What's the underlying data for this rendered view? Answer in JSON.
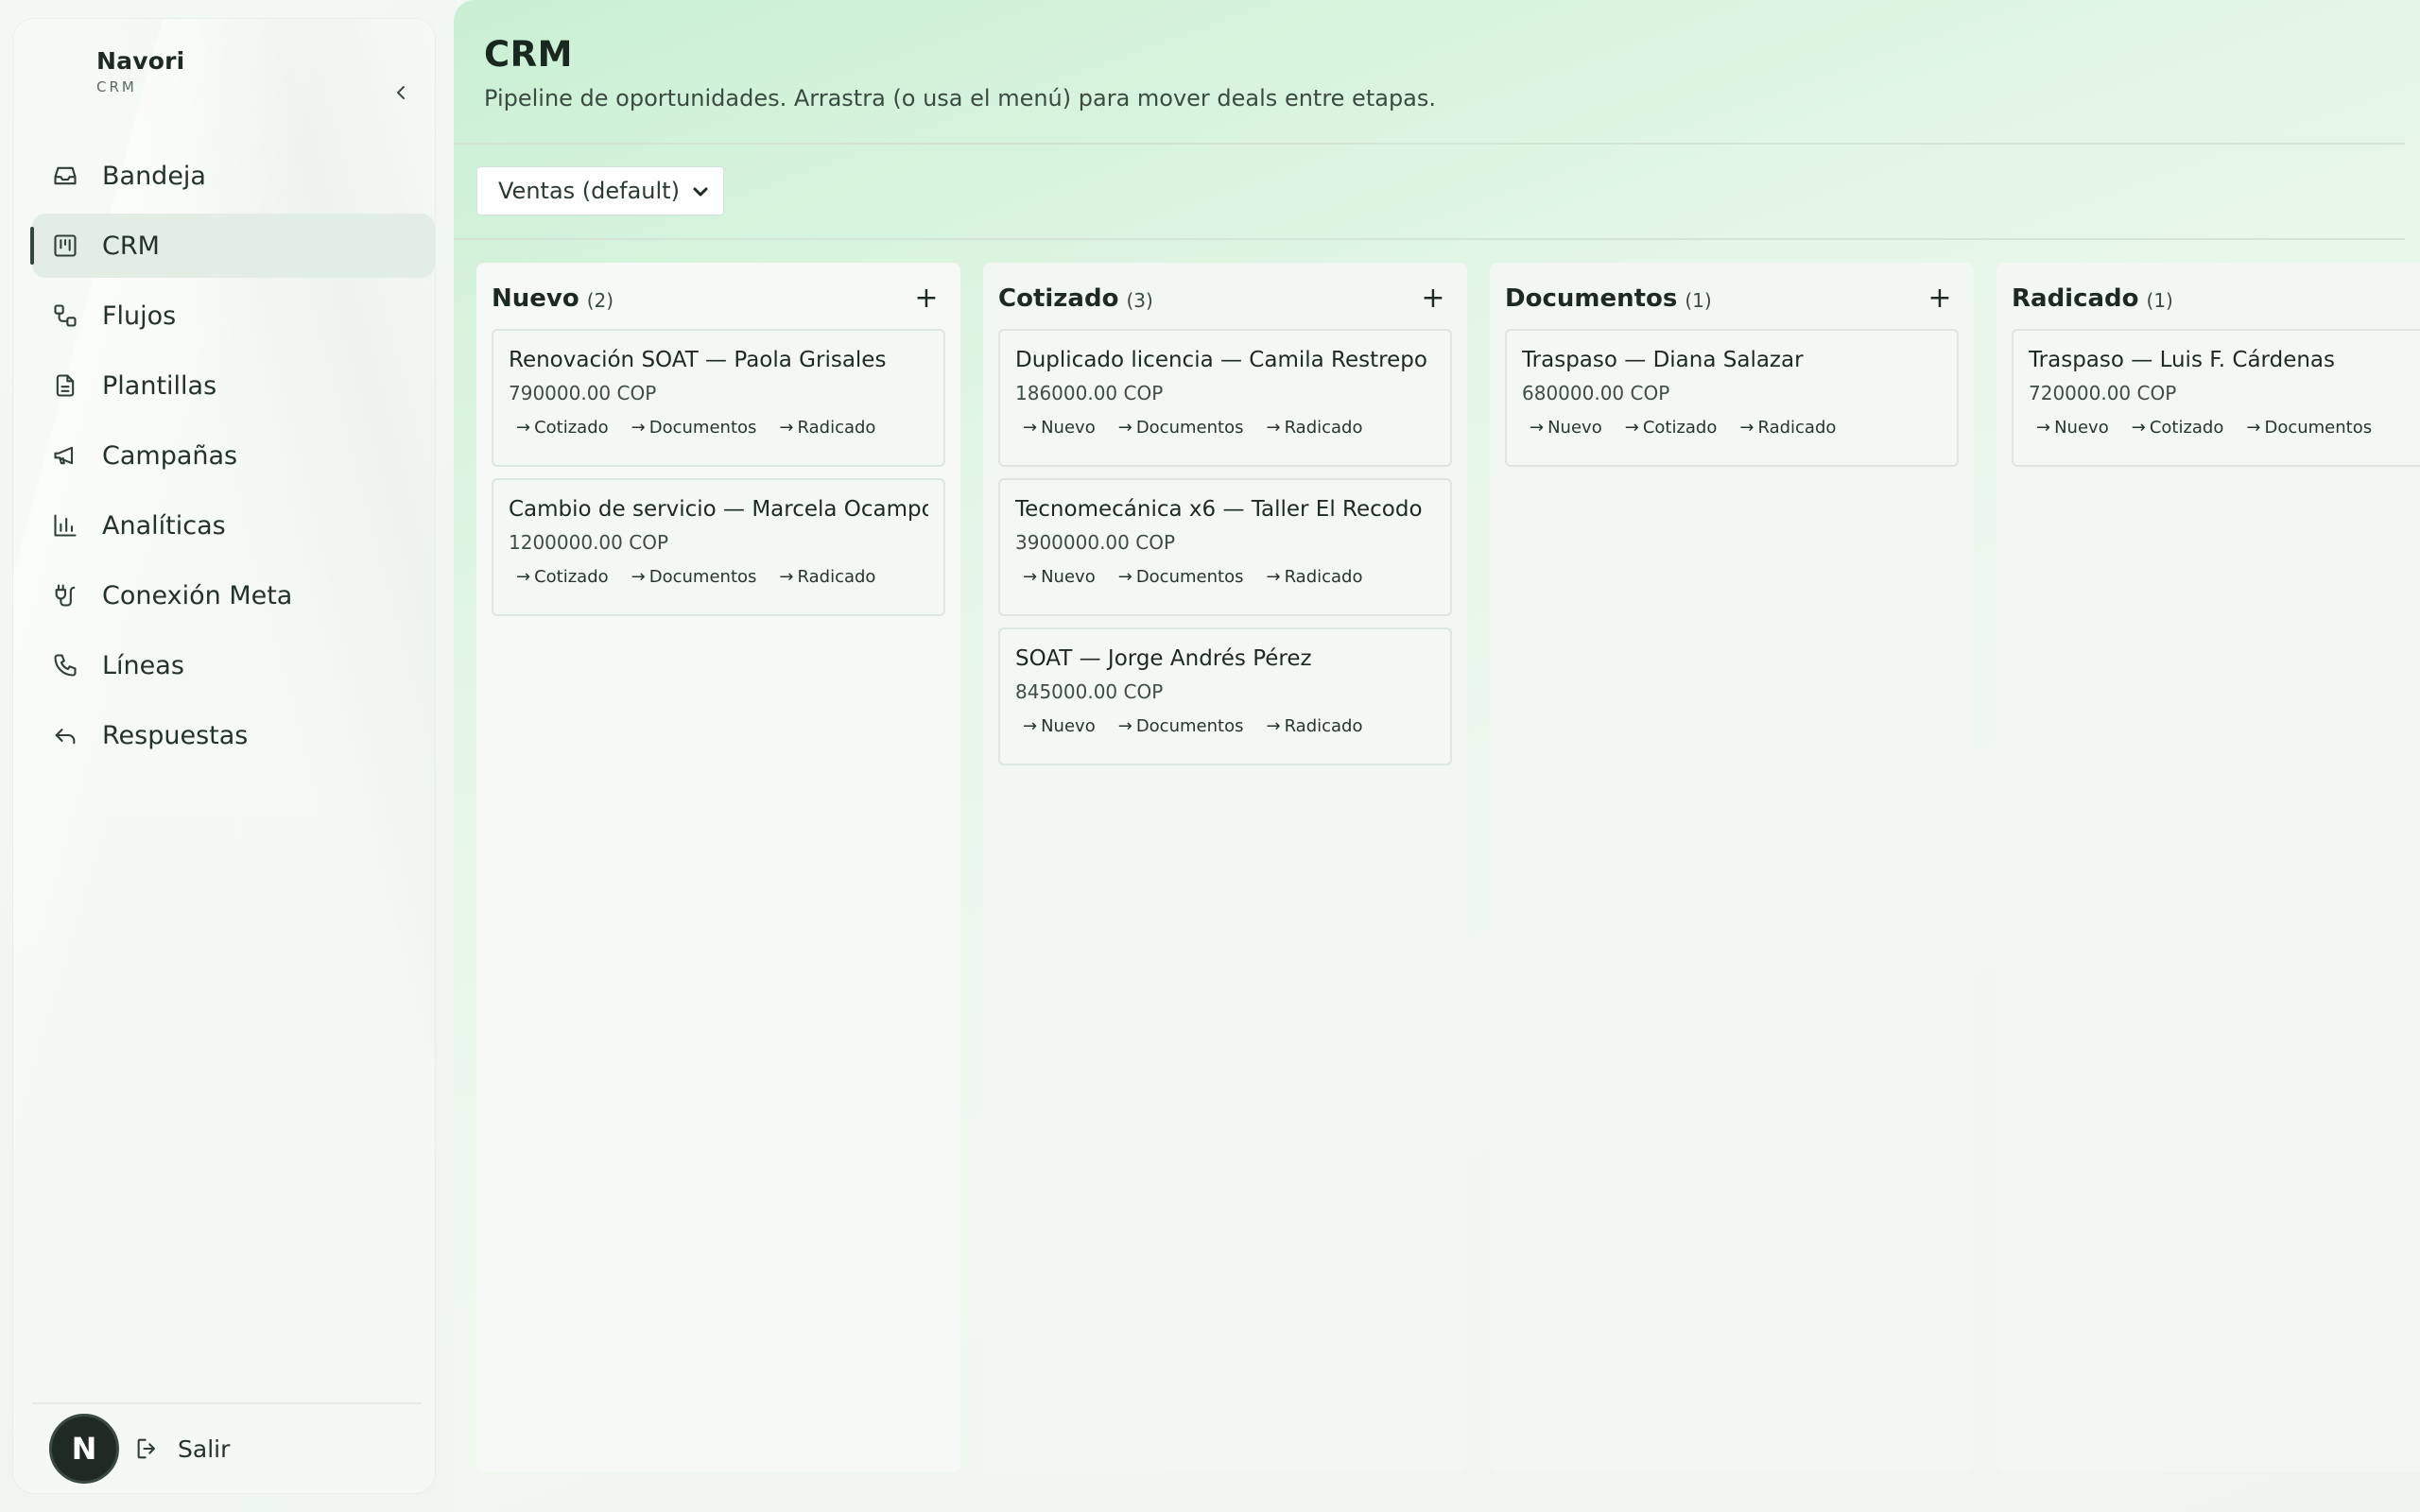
{
  "brand": {
    "name": "Navori",
    "sub": "CRM"
  },
  "nav": [
    {
      "label": "Bandeja",
      "icon": "inbox-icon"
    },
    {
      "label": "CRM",
      "icon": "kanban-icon",
      "active": true
    },
    {
      "label": "Flujos",
      "icon": "workflow-icon"
    },
    {
      "label": "Plantillas",
      "icon": "document-icon"
    },
    {
      "label": "Campañas",
      "icon": "megaphone-icon"
    },
    {
      "label": "Analíticas",
      "icon": "bar-chart-icon"
    },
    {
      "label": "Conexión Meta",
      "icon": "plug-icon"
    },
    {
      "label": "Líneas",
      "icon": "phone-icon"
    },
    {
      "label": "Respuestas",
      "icon": "reply-icon"
    }
  ],
  "footer": {
    "avatar": "N",
    "logout": "Salir"
  },
  "page": {
    "title": "CRM",
    "subtitle": "Pipeline de oportunidades. Arrastra (o usa el menú) para mover deals entre etapas."
  },
  "pipeline_select": {
    "value": "Ventas (default)"
  },
  "columns": [
    {
      "title": "Nuevo",
      "count": "(2)",
      "cards": [
        {
          "title": "Renovación SOAT — Paola Grisales",
          "amount": "790000.00 COP",
          "moves": [
            "Cotizado",
            "Documentos",
            "Radicado"
          ]
        },
        {
          "title": "Cambio de servicio — Marcela Ocampo",
          "amount": "1200000.00 COP",
          "moves": [
            "Cotizado",
            "Documentos",
            "Radicado"
          ]
        }
      ]
    },
    {
      "title": "Cotizado",
      "count": "(3)",
      "cards": [
        {
          "title": "Duplicado licencia — Camila Restrepo",
          "amount": "186000.00 COP",
          "moves": [
            "Nuevo",
            "Documentos",
            "Radicado"
          ]
        },
        {
          "title": "Tecnomecánica x6 — Taller El Recodo",
          "amount": "3900000.00 COP",
          "moves": [
            "Nuevo",
            "Documentos",
            "Radicado"
          ]
        },
        {
          "title": "SOAT — Jorge Andrés Pérez",
          "amount": "845000.00 COP",
          "moves": [
            "Nuevo",
            "Documentos",
            "Radicado"
          ]
        }
      ]
    },
    {
      "title": "Documentos",
      "count": "(1)",
      "cards": [
        {
          "title": "Traspaso — Diana Salazar",
          "amount": "680000.00 COP",
          "moves": [
            "Nuevo",
            "Cotizado",
            "Radicado"
          ]
        }
      ]
    },
    {
      "title": "Radicado",
      "count": "(1)",
      "cards": [
        {
          "title": "Traspaso — Luis F. Cárdenas",
          "amount": "720000.00 COP",
          "moves": [
            "Nuevo",
            "Cotizado",
            "Documentos"
          ]
        }
      ]
    }
  ],
  "move_arrow": "→",
  "add_symbol": "+"
}
